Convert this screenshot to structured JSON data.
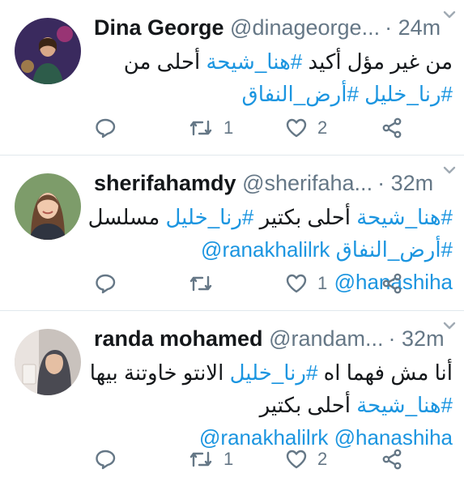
{
  "tweets": [
    {
      "name": "Dina George",
      "handle": "@dinageorge...",
      "time": "24m",
      "lines": [
        [
          "من غير مؤل أكيد ",
          {
            "tag": "#هنا_شيحة"
          },
          " أحلى من"
        ],
        [
          {
            "tag": "#رنا_خليل"
          },
          "  ",
          {
            "tag": "#أرض_النفاق"
          }
        ]
      ],
      "retweets": "1",
      "likes": "2",
      "avatar_bg": "#3a2a5e"
    },
    {
      "name": "sherifahamdy",
      "handle": "@sherifaha...",
      "time": "32m",
      "lines": [
        [
          {
            "tag": "#هنا_شيحة"
          },
          " أحلى بكتير ",
          {
            "tag": "#رنا_خليل"
          },
          " مسلسل"
        ],
        [
          {
            "tag": "#أرض_النفاق"
          },
          " ",
          {
            "mention": "@ranakhalilrk"
          }
        ],
        [
          {
            "mention": "@hanashiha"
          }
        ]
      ],
      "retweets": "",
      "likes": "1",
      "avatar_bg": "#7d9c6a"
    },
    {
      "name": "randa mohamed",
      "handle": "@randam...",
      "time": "32m",
      "lines": [
        [
          "أنا مش فهما اه ",
          {
            "tag": "#رنا_خليل"
          },
          " الانتو خاوتنة بيها"
        ],
        [
          {
            "tag": "#هنا_شيحة"
          },
          " أحلى بكتير"
        ],
        [
          {
            "mention": "@hanashiha"
          },
          " ",
          {
            "mention": "@ranakhalilrk"
          }
        ]
      ],
      "retweets": "1",
      "likes": "2",
      "avatar_bg": "#c9c2bd"
    }
  ],
  "icons": {
    "reply": "reply-icon",
    "retweet": "retweet-icon",
    "like": "like-icon",
    "share": "share-icon",
    "caret": "chevron-down-icon"
  },
  "colors": {
    "link": "#1b95e0",
    "muted": "#657786",
    "text": "#14171a",
    "divider": "#e1e8ed"
  }
}
